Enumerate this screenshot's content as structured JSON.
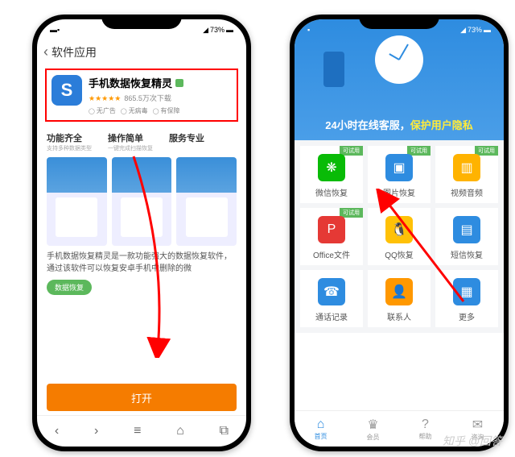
{
  "left": {
    "status_battery": "73%",
    "header_title": "软件应用",
    "app": {
      "name": "手机数据恢复精灵",
      "stars": "★★★★★",
      "downloads": "865.5万次下载",
      "badges": [
        "无广告",
        "无病毒",
        "有保障"
      ]
    },
    "tabs": [
      {
        "title": "功能齐全",
        "sub": "支持多种数据类型"
      },
      {
        "title": "操作简单",
        "sub": "一键完成扫描恢复"
      },
      {
        "title": "服务专业",
        "sub": ""
      }
    ],
    "desc_line1": "手机数据恢复精灵是一款功能强大的数据恢复软件，",
    "desc_line2": "通过该软件可以恢复安卓手机中删除的微",
    "pill": "数据恢复",
    "open_label": "打开",
    "nav": [
      "‹",
      "›",
      "≡",
      "⌂",
      "⧉"
    ]
  },
  "right": {
    "status_battery": "73%",
    "hero_text_a": "24小时在线客服，",
    "hero_text_b": "保护用户隐私",
    "ribbon": "可试用",
    "grid": [
      {
        "label": "微信恢复",
        "color": "#09bb07",
        "ribbon": true,
        "glyph": "❋"
      },
      {
        "label": "图片恢复",
        "color": "#2e8ce0",
        "ribbon": true,
        "glyph": "▣"
      },
      {
        "label": "视频音频",
        "color": "#ffb300",
        "ribbon": true,
        "glyph": "▥"
      },
      {
        "label": "Office文件",
        "color": "#e53935",
        "ribbon": true,
        "glyph": "P"
      },
      {
        "label": "QQ恢复",
        "color": "#ffc107",
        "ribbon": false,
        "glyph": "🐧"
      },
      {
        "label": "短信恢复",
        "color": "#2e8ce0",
        "ribbon": false,
        "glyph": "▤"
      },
      {
        "label": "通话记录",
        "color": "#2e8ce0",
        "ribbon": false,
        "glyph": "☎"
      },
      {
        "label": "联系人",
        "color": "#ff9800",
        "ribbon": false,
        "glyph": "👤"
      },
      {
        "label": "更多",
        "color": "#2e8ce0",
        "ribbon": false,
        "glyph": "▦"
      }
    ],
    "bottom_nav": [
      {
        "label": "首页",
        "active": true
      },
      {
        "label": "会员",
        "active": false
      },
      {
        "label": "帮助",
        "active": false
      },
      {
        "label": "咨询",
        "active": false
      }
    ]
  },
  "watermark": "知乎 @回答"
}
